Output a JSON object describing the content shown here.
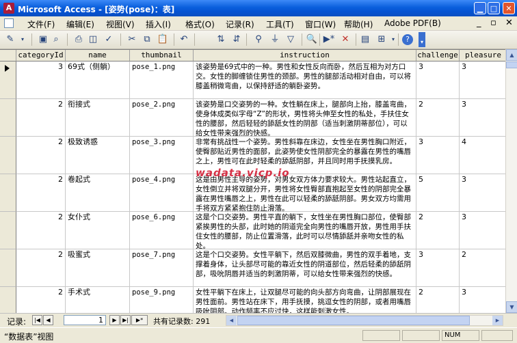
{
  "window": {
    "title": "Microsoft Access - [姿势(pose)：表]",
    "app_icon": "access-icon"
  },
  "menu": [
    {
      "label": "文件(F)"
    },
    {
      "label": "编辑(E)"
    },
    {
      "label": "视图(V)"
    },
    {
      "label": "插入(I)"
    },
    {
      "label": "格式(O)"
    },
    {
      "label": "记录(R)"
    },
    {
      "label": "工具(T)"
    },
    {
      "label": "窗口(W)"
    },
    {
      "label": "帮助(H)"
    },
    {
      "label": "Adobe PDF(B)"
    }
  ],
  "columns": [
    "categoryId",
    "name",
    "thumbnail",
    "instruction",
    "challenge",
    "pleasure"
  ],
  "rows": [
    {
      "categoryId": "3",
      "name": "69式（侧躺）",
      "thumbnail": "pose_1.png",
      "instruction": "该姿势是69式中的一种。男性和女性反向而卧，然后互相为对方口交。女性的脚缠锁住男性的颈部。男性的腿部活动相对自由，可以将膝盖稍微弯曲，以保持舒适的躺卧姿势。",
      "challenge": "3",
      "pleasure": "3"
    },
    {
      "categoryId": "2",
      "name": "衔接式",
      "thumbnail": "pose_2.png",
      "instruction": "该姿势是口交姿势的一种。女性躺在床上，腿部向上抬，膝盖弯曲，使身体成类似字母“Z”的形状，男性将头伸至女性的私处，手扶住女性的腰部，然后轻轻的舔舐女性的阴部（适当刺激阴蒂部位），可以给女性带来强烈的快感。",
      "challenge": "2",
      "pleasure": "3"
    },
    {
      "categoryId": "2",
      "name": "极致诱惑",
      "thumbnail": "pose_3.png",
      "instruction": "非常有挑战性一个姿势。男性斜靠在床边，女性坐在男性胸口附近，使臀部贴近男性的面部，此姿势使女性阴部完全的暴露在男性的嘴唇之上，男性可在此时轻柔的舔舐阴部，并且同时用手抚摸乳房。",
      "challenge": "3",
      "pleasure": "4"
    },
    {
      "categoryId": "2",
      "name": "卷起式",
      "thumbnail": "pose_4.png",
      "instruction": "这是由男性主导的姿势，对男女双方体力要求较大。男性站起直立，女性倒立并将双腿分开，男性将女性臀部直抱起至女性的阴部完全暴露在男性嘴唇之上，男性在此可以轻柔的舔舐阴部。男女双方均需用手将双方紧紧抱住防止滑落。",
      "challenge": "5",
      "pleasure": "3"
    },
    {
      "categoryId": "2",
      "name": "女仆式",
      "thumbnail": "pose_6.png",
      "instruction": "这是个口交姿势。男性平直的躺下，女性坐在男性胸口部位，使臀部紧挨男性的头部，此时她的阴道完全向男性的嘴唇开放，男性用手扶住女性的腰部，防止位置滑落，此时可以尽情舔舐并亲吻女性的私处。",
      "challenge": "2",
      "pleasure": "3"
    },
    {
      "categoryId": "2",
      "name": "吸蜜式",
      "thumbnail": "pose_7.png",
      "instruction": "这是个口交姿势。女性平躺下，然后双膝微曲，男性的双手着地，支撑着身体，让头部尽可能的靠近女性的阴道部位，然后轻柔的舔舐阴部，吸吮阴唇并适当的刺激阴蒂，可以给女性带来强烈的快感。",
      "challenge": "3",
      "pleasure": "2"
    },
    {
      "categoryId": "2",
      "name": "手术式",
      "thumbnail": "pose_9.png",
      "instruction": "女性平躺下在床上，让双腿尽可能的向头部方向弯曲，让阴部展现在男性面前。男性站在床下，用手抚摸，挑逗女性的阴部，或者用嘴唇吸吮阴部。动作频率不应过快，这样能刺激女性。",
      "challenge": "2",
      "pleasure": "3"
    }
  ],
  "record_nav": {
    "label": "记录:",
    "current": "1",
    "total_label": "共有记录数: 291"
  },
  "status": {
    "text": "“数据表”视图",
    "num": "NUM"
  },
  "watermark": "wadata.vicp.io"
}
